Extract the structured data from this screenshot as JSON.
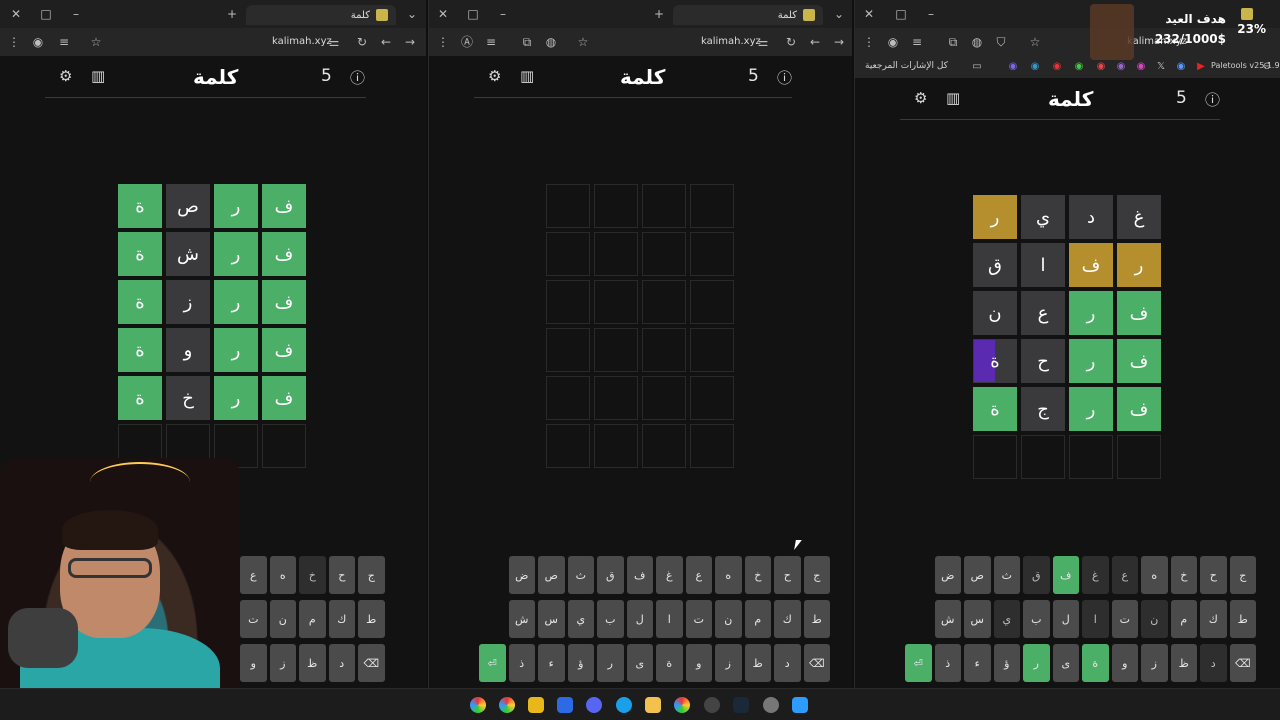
{
  "browser": {
    "tab_title": "كلمة",
    "url": "kalimah.xyz",
    "bookmarks": {
      "folder": "كل الإشارات المرجعية",
      "paletools": "Paletools v25.1.9"
    }
  },
  "game": {
    "title": "كلمة",
    "number": "5"
  },
  "boards": [
    {
      "rows": [
        [
          [
            "ف",
            "g"
          ],
          [
            "ر",
            "g"
          ],
          [
            "ص",
            "d"
          ],
          [
            "ة",
            "g"
          ]
        ],
        [
          [
            "ف",
            "g"
          ],
          [
            "ر",
            "g"
          ],
          [
            "ش",
            "d"
          ],
          [
            "ة",
            "g"
          ]
        ],
        [
          [
            "ف",
            "g"
          ],
          [
            "ر",
            "g"
          ],
          [
            "ز",
            "d"
          ],
          [
            "ة",
            "g"
          ]
        ],
        [
          [
            "ف",
            "g"
          ],
          [
            "ر",
            "g"
          ],
          [
            "و",
            "d"
          ],
          [
            "ة",
            "g"
          ]
        ],
        [
          [
            "ف",
            "g"
          ],
          [
            "ر",
            "g"
          ],
          [
            "خ",
            "d"
          ],
          [
            "ة",
            "g"
          ]
        ],
        [
          [
            "",
            "e"
          ],
          [
            "",
            "e"
          ],
          [
            "",
            "e"
          ],
          [
            "",
            "e"
          ]
        ]
      ]
    },
    {
      "rows": [
        [
          [
            "",
            "e"
          ],
          [
            "",
            "e"
          ],
          [
            "",
            "e"
          ],
          [
            "",
            "e"
          ]
        ],
        [
          [
            "",
            "e"
          ],
          [
            "",
            "e"
          ],
          [
            "",
            "e"
          ],
          [
            "",
            "e"
          ]
        ],
        [
          [
            "",
            "e"
          ],
          [
            "",
            "e"
          ],
          [
            "",
            "e"
          ],
          [
            "",
            "e"
          ]
        ],
        [
          [
            "",
            "e"
          ],
          [
            "",
            "e"
          ],
          [
            "",
            "e"
          ],
          [
            "",
            "e"
          ]
        ],
        [
          [
            "",
            "e"
          ],
          [
            "",
            "e"
          ],
          [
            "",
            "e"
          ],
          [
            "",
            "e"
          ]
        ],
        [
          [
            "",
            "e"
          ],
          [
            "",
            "e"
          ],
          [
            "",
            "e"
          ],
          [
            "",
            "e"
          ]
        ]
      ]
    },
    {
      "rows": [
        [
          [
            "غ",
            "d"
          ],
          [
            "د",
            "d"
          ],
          [
            "ي",
            "d"
          ],
          [
            "ر",
            "y"
          ]
        ],
        [
          [
            "ر",
            "y"
          ],
          [
            "ف",
            "y"
          ],
          [
            "ا",
            "d"
          ],
          [
            "ق",
            "d"
          ]
        ],
        [
          [
            "ف",
            "g"
          ],
          [
            "ر",
            "g"
          ],
          [
            "ع",
            "d"
          ],
          [
            "ن",
            "d"
          ]
        ],
        [
          [
            "ف",
            "g"
          ],
          [
            "ر",
            "g"
          ],
          [
            "ح",
            "d"
          ],
          [
            "ة",
            "p"
          ]
        ],
        [
          [
            "ف",
            "g"
          ],
          [
            "ر",
            "g"
          ],
          [
            "ج",
            "d"
          ],
          [
            "ة",
            "g"
          ]
        ],
        [
          [
            "",
            "e"
          ],
          [
            "",
            "e"
          ],
          [
            "",
            "e"
          ],
          [
            "",
            "e"
          ]
        ]
      ]
    }
  ],
  "keyboards": [
    {
      "rows": [
        [
          [
            "ج",
            ""
          ],
          [
            "ح",
            ""
          ],
          [
            "خ",
            "d"
          ],
          [
            "ه",
            ""
          ],
          [
            "ع",
            ""
          ]
        ],
        [
          [
            "ط",
            ""
          ],
          [
            "ك",
            ""
          ],
          [
            "م",
            ""
          ],
          [
            "ن",
            ""
          ],
          [
            "ت",
            ""
          ]
        ],
        [
          [
            "⌫",
            ""
          ],
          [
            "د",
            ""
          ],
          [
            "ظ",
            ""
          ],
          [
            "ز",
            ""
          ],
          [
            "و",
            ""
          ]
        ]
      ]
    },
    {
      "rows": [
        [
          [
            "ج",
            ""
          ],
          [
            "ح",
            ""
          ],
          [
            "خ",
            ""
          ],
          [
            "ه",
            ""
          ],
          [
            "ع",
            ""
          ],
          [
            "غ",
            ""
          ],
          [
            "ف",
            ""
          ],
          [
            "ق",
            ""
          ],
          [
            "ث",
            ""
          ],
          [
            "ص",
            ""
          ],
          [
            "ض",
            ""
          ]
        ],
        [
          [
            "ط",
            ""
          ],
          [
            "ك",
            ""
          ],
          [
            "م",
            ""
          ],
          [
            "ن",
            ""
          ],
          [
            "ت",
            ""
          ],
          [
            "ا",
            ""
          ],
          [
            "ل",
            ""
          ],
          [
            "ب",
            ""
          ],
          [
            "ي",
            ""
          ],
          [
            "س",
            ""
          ],
          [
            "ش",
            ""
          ]
        ],
        [
          [
            "⌫",
            ""
          ],
          [
            "د",
            ""
          ],
          [
            "ظ",
            ""
          ],
          [
            "ز",
            ""
          ],
          [
            "و",
            ""
          ],
          [
            "ة",
            ""
          ],
          [
            "ى",
            ""
          ],
          [
            "ر",
            ""
          ],
          [
            "ؤ",
            ""
          ],
          [
            "ء",
            ""
          ],
          [
            "ذ",
            ""
          ],
          [
            "⏎",
            "g"
          ]
        ]
      ]
    },
    {
      "rows": [
        [
          [
            "ج",
            ""
          ],
          [
            "ح",
            ""
          ],
          [
            "خ",
            ""
          ],
          [
            "ه",
            ""
          ],
          [
            "ع",
            "d"
          ],
          [
            "غ",
            "d"
          ],
          [
            "ف",
            "g"
          ],
          [
            "ق",
            "d"
          ],
          [
            "ث",
            ""
          ],
          [
            "ص",
            ""
          ],
          [
            "ض",
            ""
          ]
        ],
        [
          [
            "ط",
            ""
          ],
          [
            "ك",
            ""
          ],
          [
            "م",
            ""
          ],
          [
            "ن",
            "d"
          ],
          [
            "ت",
            ""
          ],
          [
            "ا",
            "d"
          ],
          [
            "ل",
            ""
          ],
          [
            "ب",
            ""
          ],
          [
            "ي",
            "d"
          ],
          [
            "س",
            ""
          ],
          [
            "ش",
            ""
          ]
        ],
        [
          [
            "⌫",
            ""
          ],
          [
            "د",
            "d"
          ],
          [
            "ظ",
            ""
          ],
          [
            "ز",
            ""
          ],
          [
            "و",
            ""
          ],
          [
            "ة",
            "g"
          ],
          [
            "ى",
            ""
          ],
          [
            "ر",
            "g"
          ],
          [
            "ؤ",
            ""
          ],
          [
            "ء",
            ""
          ],
          [
            "ذ",
            ""
          ],
          [
            "⏎",
            "g"
          ]
        ]
      ]
    }
  ],
  "overlay": {
    "percent": "23%",
    "goal": "هدف العيد",
    "amount": "232/1000$"
  }
}
